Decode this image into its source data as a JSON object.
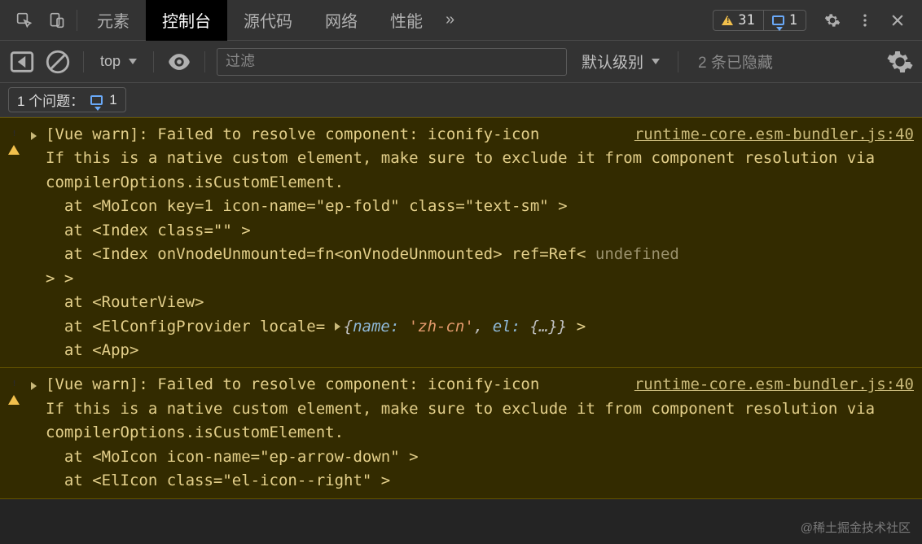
{
  "toolbar": {
    "tabs": [
      "元素",
      "控制台",
      "源代码",
      "网络",
      "性能"
    ],
    "more": "»",
    "warn_count": "31",
    "msg_count": "1"
  },
  "subbar": {
    "context": "top",
    "filter_placeholder": "过滤",
    "level": "默认级别",
    "hidden": "2 条已隐藏"
  },
  "issues": {
    "label": "1 个问题：",
    "count": "1"
  },
  "entries": [
    {
      "source": "runtime-core.esm-bundler.js:40",
      "head": "[Vue warn]: Failed to resolve component: iconify-icon",
      "body": "If this is a native custom element, make sure to exclude it from component resolution via compilerOptions.isCustomElement.",
      "stack": [
        "  at <MoIcon key=1 icon-name=\"ep-fold\" class=\"text-sm\" >",
        "  at <Index class=\"\" >",
        "  at <Index onVnodeUnmounted=fn<onVnodeUnmounted> ref=Ref< ",
        "> >",
        "  at <RouterView>",
        "  at <ElConfigProvider locale= ",
        "  at <App>"
      ],
      "undef": "undefined",
      "obj_name": "name:",
      "obj_name_val": "'zh-cn'",
      "obj_el": "el:",
      "obj_el_val": "{…}",
      "obj_tail": " >"
    },
    {
      "source": "runtime-core.esm-bundler.js:40",
      "head": "[Vue warn]: Failed to resolve component: iconify-icon",
      "body": "If this is a native custom element, make sure to exclude it from component resolution via compilerOptions.isCustomElement.",
      "stack": [
        "  at <MoIcon icon-name=\"ep-arrow-down\" >",
        "  at <ElIcon class=\"el-icon--right\" >"
      ]
    }
  ],
  "watermark": "@稀土掘金技术社区"
}
